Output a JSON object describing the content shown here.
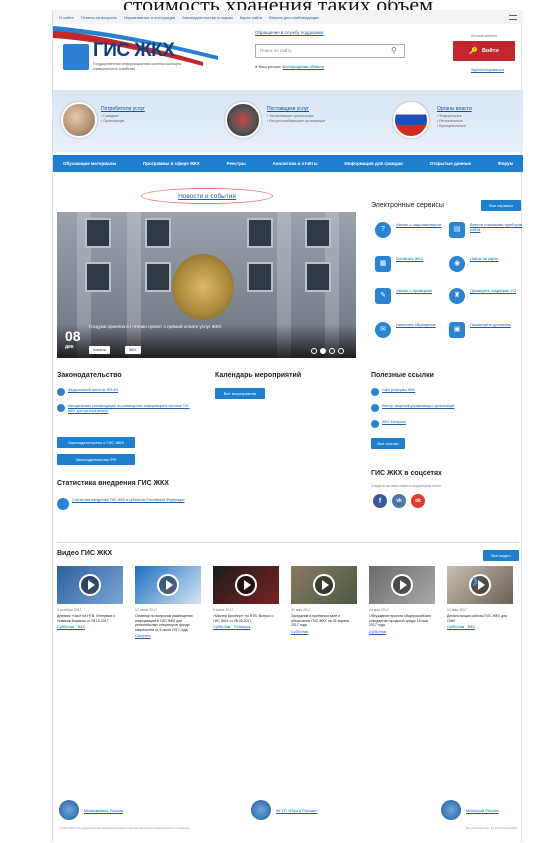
{
  "top_title": "стоимость хранения таких объем",
  "topbar": {
    "items": [
      "О сайте",
      "Ответы на вопросы",
      "Нормативные и инструкции",
      "Законодательство и нормы",
      "Карта сайта",
      "Версия для слабовидящих"
    ]
  },
  "header": {
    "logo": "ГИС ЖКХ",
    "logo_sub": "Государственная информационная система жилищно-коммунального хозяйства",
    "helpdesk": "Обращение в службу поддержки",
    "search_placeholder": "Поиск по сайту",
    "region_label": "Ваш регион:",
    "region_link": "Белгородская область",
    "login_label": "Личный кабинет",
    "login_button": "Войти",
    "register_link": "Зарегистрироваться"
  },
  "groups": [
    {
      "title": "Потребители услуг",
      "items": [
        "• Граждане",
        "• Организации"
      ]
    },
    {
      "title": "Поставщики услуг",
      "items": [
        "• Управляющие организации",
        "• Ресурсоснабжающие организации"
      ]
    },
    {
      "title": "Органы власти",
      "items": [
        "• Федеральные",
        "• Региональные",
        "• Муниципальные"
      ]
    }
  ],
  "nav": [
    "Обучающие материалы",
    "Программы в сфере ЖКХ",
    "Реестры",
    "Аналитика и отчёты",
    "Информация для граждан",
    "Открытые данные",
    "Форум"
  ],
  "news": {
    "title": "Новости и события",
    "day": "08",
    "month": "дек",
    "caption": "Госдума приняла в I чтении проект о прямой оплате услуг ЖКХ",
    "tags": [
      "новости",
      "ЖКХ"
    ]
  },
  "services": {
    "title": "Электронные сервисы",
    "all_button": "Все сервисы",
    "items": [
      "Узнать о задолженности",
      "Внести показания приборов учёта",
      "Оплатить ЖКУ",
      "Найти на карте",
      "Узнать о проверках",
      "Проверить лицензию УО",
      "Написать обращение",
      "Посмотреть договоры"
    ]
  },
  "legislation": {
    "title": "Законодательство",
    "docs": [
      "Федеральный закон № 209-ФЗ",
      "Методические рекомендации по размещению информации в системе ГИС ЖКХ для органов власти"
    ],
    "buttons": [
      "Законодательство о ГИС ЖКХ",
      "Законодательство РФ"
    ]
  },
  "calendar": {
    "title": "Календарь мероприятий",
    "button": "Все мероприятия"
  },
  "links": {
    "title": "Полезные ссылки",
    "items": [
      "Сайт реформы ЖКХ",
      "Реестр лицензий управляющих организаций",
      "ЖКХ Контроль"
    ],
    "button": "Все ссылки"
  },
  "stats": {
    "title": "Статистика внедрения ГИС ЖКХ",
    "link": "Статистика внедрения ГИС ЖКХ в субъектах Российской Федерации"
  },
  "social": {
    "title": "ГИС ЖКХ в соцсетях",
    "note": "Следите за новостями в социальных сетях",
    "icons": [
      "f",
      "vk",
      "ok"
    ]
  },
  "videos": {
    "title": "Видео ГИС ЖКХ",
    "all_button": "Все видео",
    "items": [
      {
        "date": "5 октября 2017",
        "title": "Дневник «Час» на НТВ: Интервью с Новиков Ворвали от 28.10.2017",
        "links": [
          "Субботник",
          "ЖКХ"
        ]
      },
      {
        "date": "12 июля 2017",
        "title": "Семинар по вопросам размещения информации в ГИС ЖКХ для региональных операторов фонда капремонта от 6 июля 2017 года",
        "links": [
          "Смотреть"
        ]
      },
      {
        "date": "5 июня 2017",
        "title": "«Мистер Брюберг» на НТВ: Вопрос о ГИС ЖКХ от 28.05.2017",
        "links": [
          "Субботник",
          "ТВ-выпуск"
        ]
      },
      {
        "date": "31 мая 2017",
        "title": "Заседание в приёмном зале и объяснение ГИС ЖКХ на 31 апреля 2017 года",
        "links": [
          "Субботник"
        ]
      },
      {
        "date": "24 мая 2017",
        "title": "Обсуждение проекта общероссийских стандартов городской среды 19 мая 2017 года",
        "links": [
          "Субботник"
        ]
      },
      {
        "date": "19 мая 2017",
        "title": "Демонстрация работы ГИС ЖКХ для СМИ",
        "links": [
          "Субботник",
          "ЖКХ"
        ]
      }
    ]
  },
  "footer": {
    "orgs": [
      "Минкомсвязь России",
      "ФГУП «Почта России»",
      "Минстрой России"
    ],
    "copyright": "© 2014-2017 Государственная информационная система жилищно-коммунального хозяйства",
    "version": "Версия системы: 11.0.0 сборка 0000"
  }
}
